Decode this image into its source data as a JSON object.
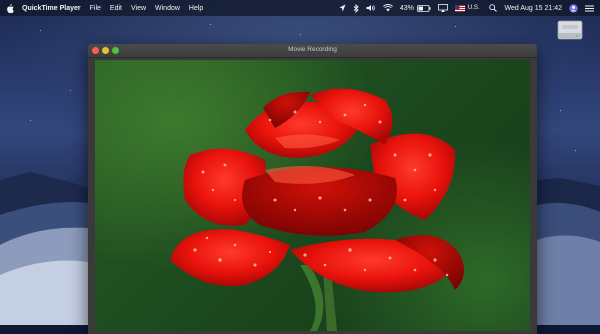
{
  "menubar": {
    "app_name": "QuickTime Player",
    "items": [
      "File",
      "Edit",
      "View",
      "Window",
      "Help"
    ],
    "battery_percent": "43%",
    "input_source": "U.S.",
    "clock": "Wed Aug 15  21:42"
  },
  "window": {
    "title": "Movie Recording"
  },
  "colors": {
    "close": "#fc5b57",
    "minimize": "#e5bf3c",
    "maximize": "#57c038",
    "rose": "#e8120c",
    "foliage": "#2a5e24"
  },
  "icons": [
    "apple-icon",
    "cursor-icon",
    "bluetooth-icon",
    "volume-icon",
    "wifi-icon",
    "battery-icon",
    "airplay-icon",
    "flag-icon",
    "search-icon",
    "user-icon",
    "menu-list-icon",
    "hard-drive-icon"
  ]
}
